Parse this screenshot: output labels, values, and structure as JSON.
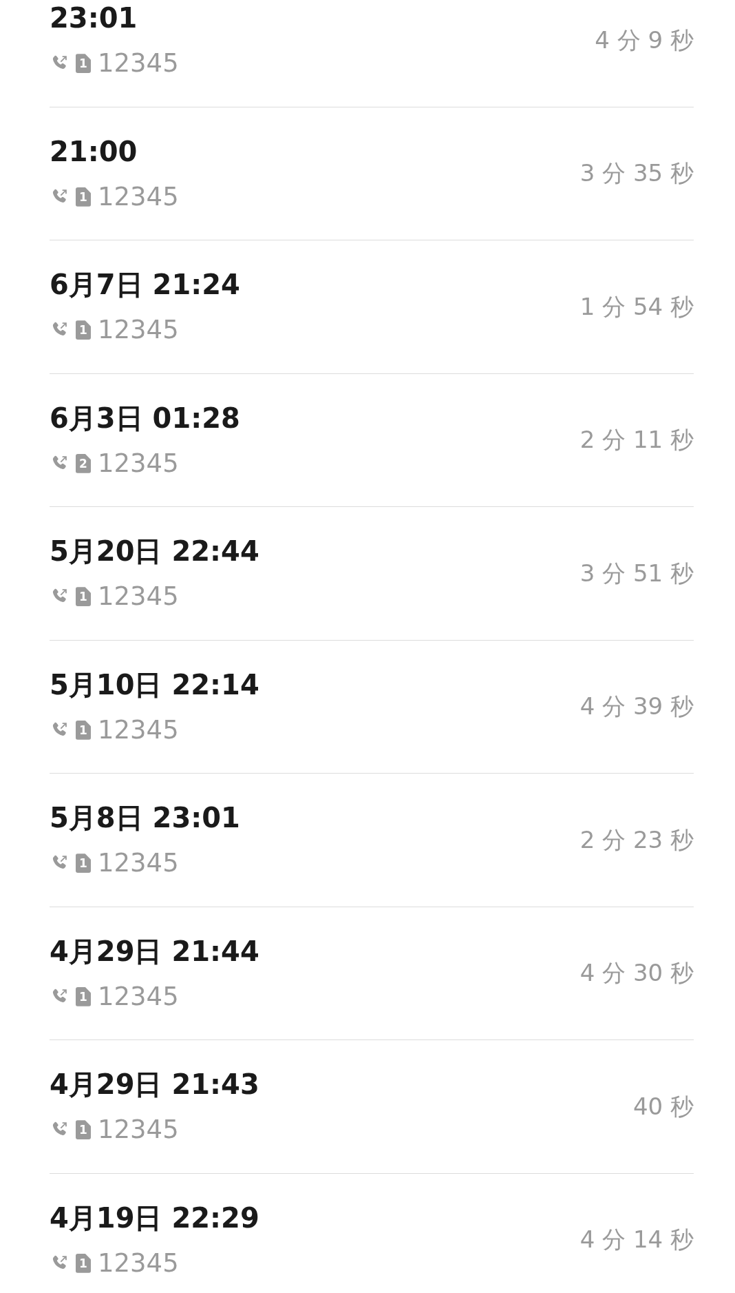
{
  "calls": [
    {
      "time": "23:01",
      "sim": "1",
      "number": "12345",
      "duration": "4 分 9 秒"
    },
    {
      "time": "21:00",
      "sim": "1",
      "number": "12345",
      "duration": "3 分 35 秒"
    },
    {
      "time": "6月7日 21:24",
      "sim": "1",
      "number": "12345",
      "duration": "1 分 54 秒"
    },
    {
      "time": "6月3日 01:28",
      "sim": "2",
      "number": "12345",
      "duration": "2 分 11 秒"
    },
    {
      "time": "5月20日 22:44",
      "sim": "1",
      "number": "12345",
      "duration": "3 分 51 秒"
    },
    {
      "time": "5月10日 22:14",
      "sim": "1",
      "number": "12345",
      "duration": "4 分 39 秒"
    },
    {
      "time": "5月8日 23:01",
      "sim": "1",
      "number": "12345",
      "duration": "2 分 23 秒"
    },
    {
      "time": "4月29日 21:44",
      "sim": "1",
      "number": "12345",
      "duration": "4 分 30 秒"
    },
    {
      "time": "4月29日 21:43",
      "sim": "1",
      "number": "12345",
      "duration": "40 秒"
    },
    {
      "time": "4月19日 22:29",
      "sim": "1",
      "number": "12345",
      "duration": "4 分 14 秒"
    }
  ]
}
